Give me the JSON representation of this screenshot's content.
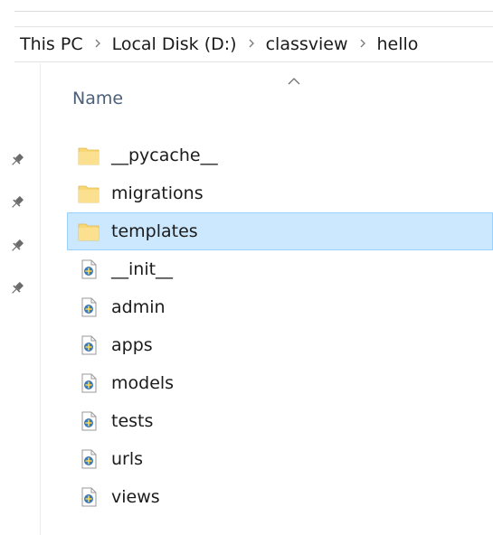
{
  "breadcrumb": {
    "items": [
      "This PC",
      "Local Disk (D:)",
      "classview",
      "hello"
    ],
    "separator_icon": "chevron-right-icon"
  },
  "column_header": {
    "label": "Name",
    "sort_icon": "sort-ascending-icon"
  },
  "nav_pane": {
    "pins": [
      "pin-icon",
      "pin-icon",
      "pin-icon",
      "pin-icon"
    ]
  },
  "files": [
    {
      "name": "__pycache__",
      "type": "folder",
      "icon": "folder-icon"
    },
    {
      "name": "migrations",
      "type": "folder",
      "icon": "folder-icon"
    },
    {
      "name": "templates",
      "type": "folder",
      "icon": "folder-icon",
      "selected": true
    },
    {
      "name": "__init__",
      "type": "python",
      "icon": "python-file-icon"
    },
    {
      "name": "admin",
      "type": "python",
      "icon": "python-file-icon"
    },
    {
      "name": "apps",
      "type": "python",
      "icon": "python-file-icon"
    },
    {
      "name": "models",
      "type": "python",
      "icon": "python-file-icon"
    },
    {
      "name": "tests",
      "type": "python",
      "icon": "python-file-icon"
    },
    {
      "name": "urls",
      "type": "python",
      "icon": "python-file-icon"
    },
    {
      "name": "views",
      "type": "python",
      "icon": "python-file-icon"
    }
  ],
  "colors": {
    "selection_bg": "#cce8ff",
    "selection_border": "#99d1ff",
    "header_text": "#4c607a",
    "folder": "#f8d775"
  }
}
